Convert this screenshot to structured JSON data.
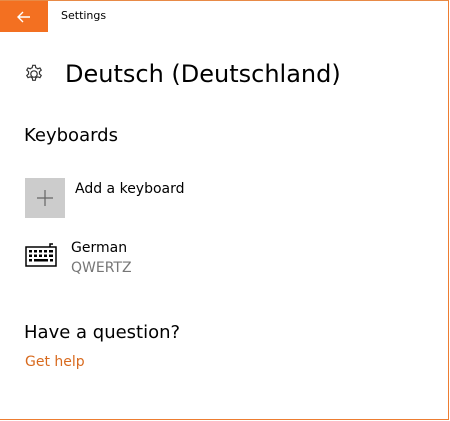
{
  "window": {
    "title": "Settings"
  },
  "header": {
    "icon": "gear-icon",
    "title": "Deutsch (Deutschland)"
  },
  "keyboards": {
    "section_title": "Keyboards",
    "add_label": "Add a keyboard",
    "items": [
      {
        "name": "German",
        "layout": "QWERTZ",
        "icon": "keyboard-icon"
      }
    ]
  },
  "help": {
    "section_title": "Have a question?",
    "link_label": "Get help"
  },
  "colors": {
    "accent": "#f37021",
    "link": "#d86a1e",
    "secondary_text": "#767676",
    "tile": "#cccccc"
  }
}
